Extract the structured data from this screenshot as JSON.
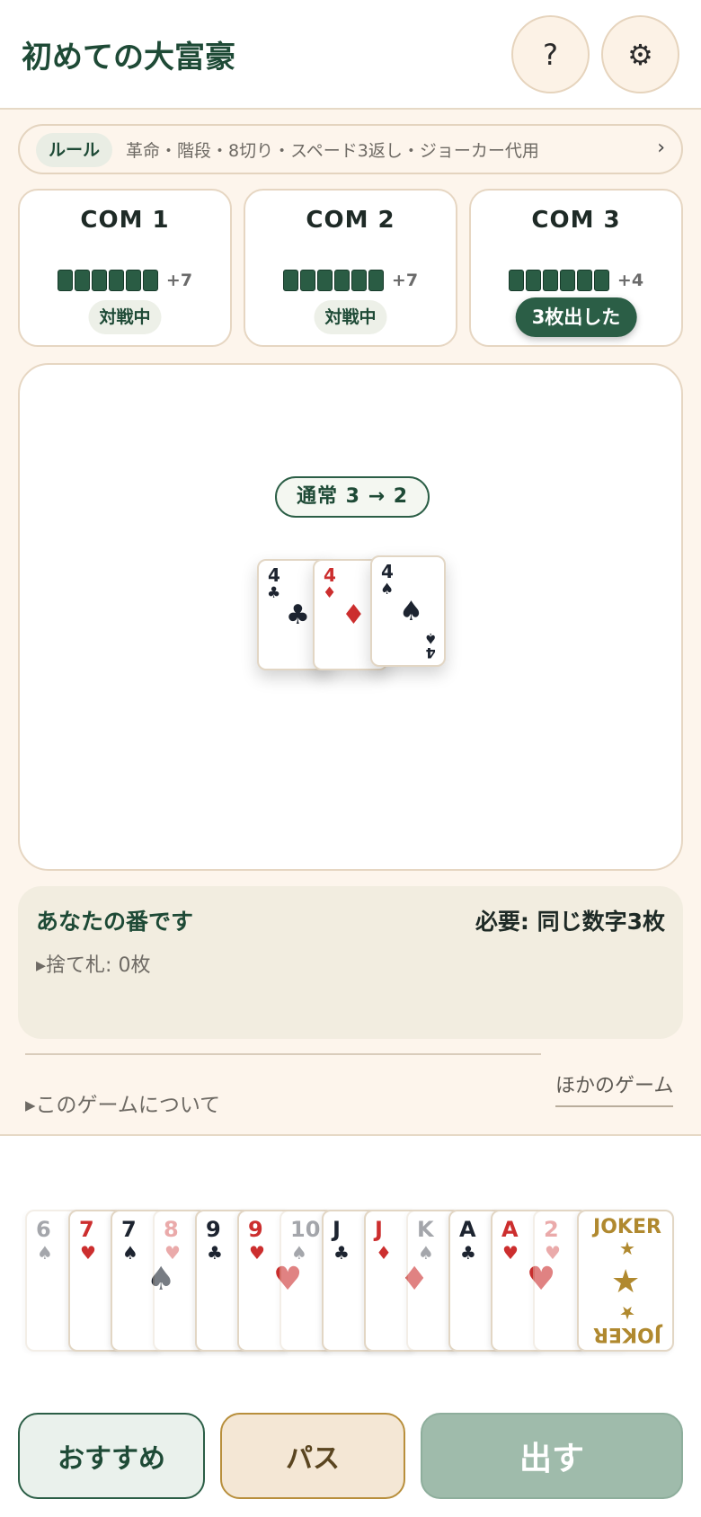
{
  "header": {
    "title": "初めての大富豪",
    "help_label": "?",
    "settings_label": "⚙"
  },
  "rules": {
    "tag": "ルール",
    "text": "革命・階段・8切り・スペード3返し・ジョーカー代用",
    "chevron": "›"
  },
  "opponents": [
    {
      "name": "COM 1",
      "extra": "+7",
      "status": "対戦中",
      "active": false
    },
    {
      "name": "COM 2",
      "extra": "+7",
      "status": "対戦中",
      "active": false
    },
    {
      "name": "COM 3",
      "extra": "+4",
      "status": "3枚出した",
      "active": true
    }
  ],
  "pile": {
    "badge": "通常 3 → 2",
    "cards": [
      {
        "rank": "4",
        "suit": "♣",
        "color": "black"
      },
      {
        "rank": "4",
        "suit": "♦",
        "color": "red"
      },
      {
        "rank": "4",
        "suit": "♠",
        "color": "black"
      }
    ]
  },
  "info": {
    "turn": "あなたの番です",
    "required": "必要: 同じ数字3枚",
    "discard": "▸捨て札: 0枚"
  },
  "footer": {
    "about": "▸このゲームについて",
    "other_games": "ほかのゲーム"
  },
  "hand": [
    {
      "rank": "6",
      "suit": "♠",
      "color": "black",
      "playable": false
    },
    {
      "rank": "7",
      "suit": "♥",
      "color": "red",
      "playable": true
    },
    {
      "rank": "7",
      "suit": "♠",
      "color": "black",
      "playable": true
    },
    {
      "rank": "8",
      "suit": "♥",
      "color": "red",
      "playable": false
    },
    {
      "rank": "9",
      "suit": "♣",
      "color": "black",
      "playable": true
    },
    {
      "rank": "9",
      "suit": "♥",
      "color": "red",
      "playable": true
    },
    {
      "rank": "10",
      "suit": "♠",
      "color": "black",
      "playable": false
    },
    {
      "rank": "J",
      "suit": "♣",
      "color": "black",
      "playable": true
    },
    {
      "rank": "J",
      "suit": "♦",
      "color": "red",
      "playable": true
    },
    {
      "rank": "K",
      "suit": "♠",
      "color": "black",
      "playable": false
    },
    {
      "rank": "A",
      "suit": "♣",
      "color": "black",
      "playable": true
    },
    {
      "rank": "A",
      "suit": "♥",
      "color": "red",
      "playable": true
    },
    {
      "rank": "2",
      "suit": "♥",
      "color": "red",
      "playable": false
    },
    {
      "rank": "JOKER",
      "suit": "★",
      "color": "gold",
      "playable": true
    }
  ],
  "actions": {
    "recommend": "おすすめ",
    "pass": "パス",
    "play": "出す"
  },
  "colors": {
    "primary": "#2b5e46",
    "background": "#fdf5ec",
    "red_suit": "#cc2e2e",
    "joker_gold": "#b0892f"
  }
}
